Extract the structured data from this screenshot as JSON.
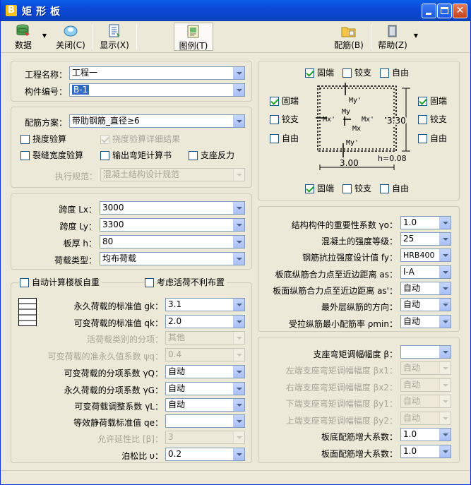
{
  "window": {
    "title": "矩形板"
  },
  "toolbar": {
    "data": "数据",
    "close": "关闭(C)",
    "display": "显示(X)",
    "legend": "图例(T)",
    "rebar": "配筋(B)",
    "help": "帮助(Z)"
  },
  "basic": {
    "project_label": "工程名称：",
    "project_value": "工程一",
    "member_label": "构件编号：",
    "member_value": "B-1"
  },
  "scheme": {
    "label": "配筋方案：",
    "value": "带肋钢筋_直径≥6",
    "deflection": "挠度验算",
    "deflection_detail": "挠度验算详细结果",
    "crack": "裂缝宽度验算",
    "moment_calc": "输出弯矩计算书",
    "support_reaction": "支座反力",
    "code_label": "执行规范：",
    "code_value": "混凝土结构设计规范"
  },
  "geometry": {
    "lx_label": "跨度 Lx：",
    "lx": "3000",
    "ly_label": "跨度 Ly：",
    "ly": "3300",
    "h_label": "板厚 h：",
    "h": "80",
    "load_type_label": "荷载类型：",
    "load_type": "均布荷载"
  },
  "loads": {
    "auto_selfweight": "自动计算楼板自重",
    "live_unfav": "考虑活荷不利布置",
    "gk_label": "永久荷载的标准值 gk：",
    "gk": "3.1",
    "qk_label": "可变荷载的标准值 qk：",
    "qk": "2.0",
    "live_cat_label": "活荷载类别的分项：",
    "live_cat": "其他",
    "psiq_label": "可变荷载的准永久值系数 ψq：",
    "psiq": "0.4",
    "gammaQ_label": "可变荷载的分项系数 γQ：",
    "gammaQ": "自动",
    "gammaG_label": "永久荷载的分项系数 γG：",
    "gammaG": "自动",
    "gammaL_label": "可变荷载调整系数 γL：",
    "gammaL": "自动",
    "qe_label": "等效静荷载标准值 qe：",
    "qe": "",
    "beta_label": "允许延性比 [β]：",
    "beta": "3",
    "poisson_label": "泊松比 υ：",
    "poisson": "0.2"
  },
  "boundary": {
    "fixed": "固端",
    "hinged": "铰支",
    "free": "自由",
    "diagram": {
      "my_top": "My'",
      "my": "My",
      "mx_left": "Mx'",
      "mx_right": "Mx'",
      "mx": "Mx",
      "my_bottom": "My'",
      "dim_y": "3.30",
      "dim_x": "3.00",
      "thickness": "h=0.08"
    }
  },
  "materials": {
    "gamma0_label": "结构构件的重要性系数 γo：",
    "gamma0": "1.0",
    "concrete_label": "混凝土的强度等级：",
    "concrete": "25",
    "fy_label": "钢筋抗拉强度设计值 fy：",
    "fy": "HRB400",
    "as_label": "板底纵筋合力点至近边距离 as：",
    "as": "Ⅰ-A",
    "as2_label": "板面纵筋合力点至近边距离 as'：",
    "as2": "自动",
    "direction_label": "最外层纵筋的方向：",
    "direction": "自动",
    "rho_label": "受拉纵筋最小配筋率 ρmin：",
    "rho": "自动"
  },
  "adjust": {
    "beta_label": "支座弯矩调幅幅度 β：",
    "beta": "",
    "bx1_label": "左端支座弯矩调幅幅度 βx1：",
    "bx1": "自动",
    "bx2_label": "右端支座弯矩调幅幅度 βx2：",
    "bx2": "自动",
    "by1_label": "下端支座弯矩调幅幅度 βy1：",
    "by1": "自动",
    "by2_label": "上端支座弯矩调幅幅度 βy2：",
    "by2": "自动",
    "bottom_amp_label": "板底配筋增大系数：",
    "bottom_amp": "1.0",
    "top_amp_label": "板面配筋增大系数：",
    "top_amp": "1.0"
  }
}
